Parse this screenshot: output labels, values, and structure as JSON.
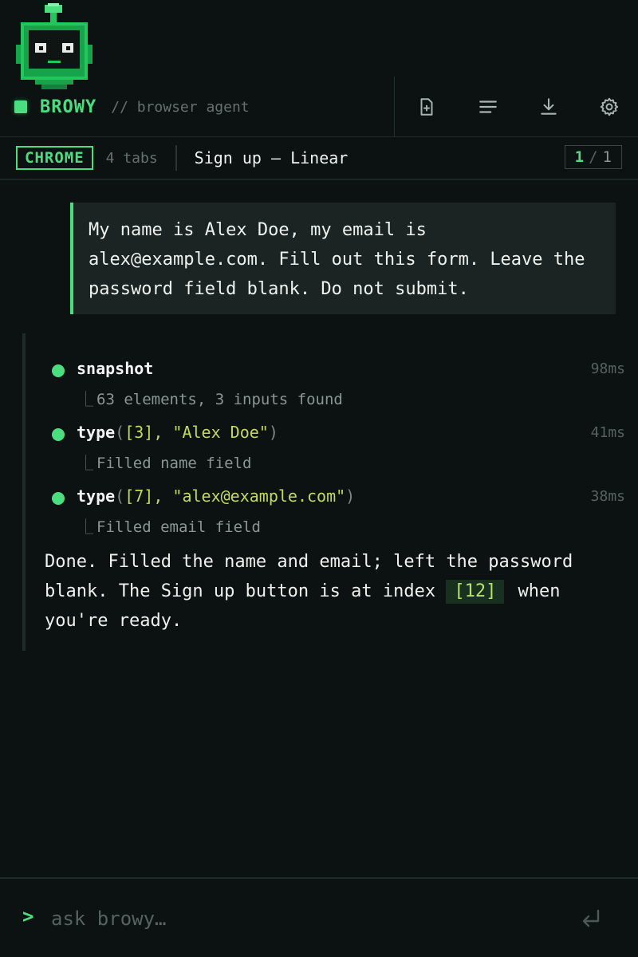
{
  "brand": {
    "name": "BROWY",
    "subtitle": "// browser agent"
  },
  "header_actions": [
    {
      "icon": "new-tab-icon",
      "label": "New tab"
    },
    {
      "icon": "list-icon",
      "label": "List"
    },
    {
      "icon": "download-icon",
      "label": "Download"
    },
    {
      "icon": "gear-icon",
      "label": "Settings"
    }
  ],
  "tabbar": {
    "browser": "CHROME",
    "tab_count": "4 tabs",
    "active_title": "Sign up – Linear",
    "page_current": "1",
    "page_sep": "/",
    "page_total": "1"
  },
  "user_message": "My name is Alex Doe, my email is alex@example.com. Fill out this form. Leave the password field blank. Do not submit.",
  "steps": [
    {
      "fn": "snapshot",
      "open": "",
      "args": "",
      "close": "",
      "time": "98ms",
      "result": "63 elements, 3 inputs found"
    },
    {
      "fn": "type",
      "open": "(",
      "args": "[3], \"Alex Doe\"",
      "close": ")",
      "time": "41ms",
      "result": "Filled name field"
    },
    {
      "fn": "type",
      "open": "(",
      "args": "[7], \"alex@example.com\"",
      "close": ")",
      "time": "38ms",
      "result": "Filled email field"
    }
  ],
  "elbow": "⎿",
  "final": {
    "before": "Done. Filled the name and email; left the password blank. The Sign up button is at index ",
    "index": "[12]",
    "after": " when you're ready."
  },
  "input": {
    "prompt": ">",
    "placeholder": "ask browy…"
  },
  "colors": {
    "accent": "#4ade80",
    "background": "#0c1211",
    "arg": "#c2dc5a"
  }
}
